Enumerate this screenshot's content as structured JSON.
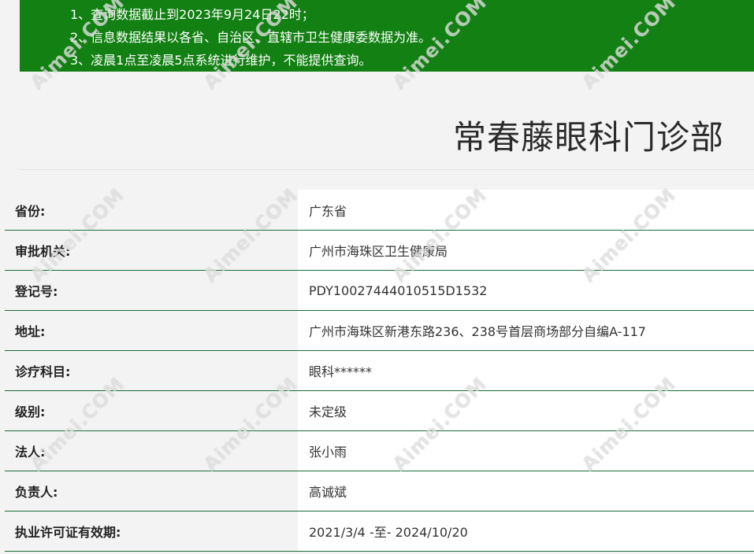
{
  "notice": {
    "lines": [
      "1、查询数据截止到2023年9月24日22时；",
      "2、信息数据结果以各省、自治区、直辖市卫生健康委数据为准。",
      "3、凌晨1点至凌晨5点系统进行维护，不能提供查询。"
    ]
  },
  "clinic": {
    "title": "常春藤眼科门诊部"
  },
  "info": {
    "rows": [
      {
        "label": "省份:",
        "value": "广东省"
      },
      {
        "label": "审批机关:",
        "value": "广州市海珠区卫生健康局"
      },
      {
        "label": "登记号:",
        "value": "PDY10027444010515D1532"
      },
      {
        "label": "地址:",
        "value": "广州市海珠区新港东路236、238号首层商场部分自编A-117"
      },
      {
        "label": "诊疗科目:",
        "value": "眼科******"
      },
      {
        "label": "级别:",
        "value": "未定级"
      },
      {
        "label": "法人:",
        "value": "张小雨"
      },
      {
        "label": "负责人:",
        "value": "高诚斌"
      },
      {
        "label": "执业许可证有效期:",
        "value": "2021/3/4 -至- 2024/10/20"
      }
    ]
  },
  "watermark": {
    "text": "Aimei.COM"
  },
  "colors": {
    "notice_bg": "#128012",
    "row_border": "#1e6b3a"
  }
}
